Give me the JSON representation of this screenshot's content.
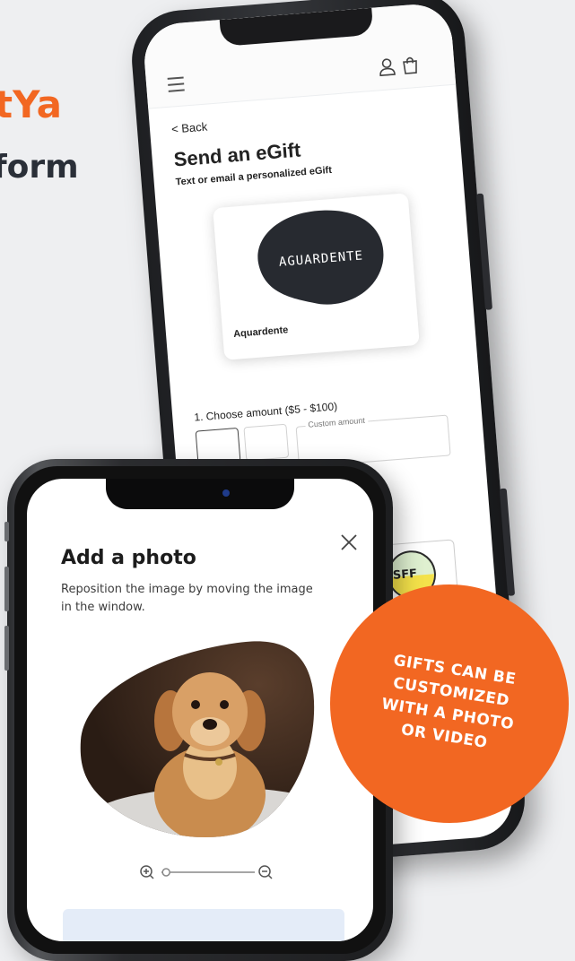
{
  "headline": {
    "line1": "tYa",
    "line2": "form"
  },
  "web_form": {
    "back": "< Back",
    "title": "Send an eGift",
    "subtitle": "Text or email a personalized eGift",
    "card": {
      "logo_text": "AGUARDENTE",
      "name": "Aquardente"
    },
    "amount_label": "1. Choose amount ($5 - $100)",
    "custom_amount_label": "Custom amount",
    "thumb_text": "SFF"
  },
  "photo_modal": {
    "title": "Add a photo",
    "description": "Reposition the image by moving the image in the window.",
    "zoom_in_icon": "zoom-in-icon",
    "zoom_out_icon": "zoom-out-icon",
    "zoom_level": 0.05
  },
  "badge": {
    "text": "GIFTS CAN BE\nCUSTOMIZED\nWITH A PHOTO\nOR VIDEO"
  },
  "colors": {
    "accent": "#f26722",
    "background": "#eeeff1",
    "dark_text": "#2a2f38"
  }
}
